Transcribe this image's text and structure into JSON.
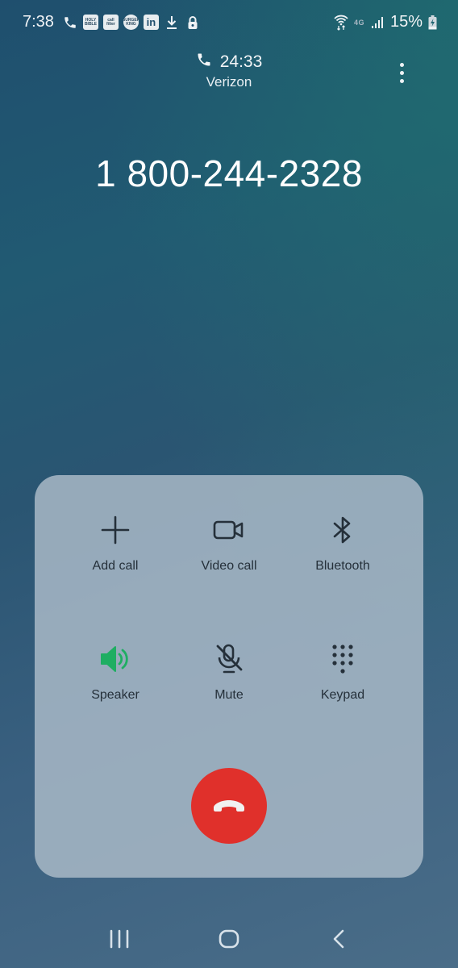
{
  "status_bar": {
    "time": "7:38",
    "notification_icons": [
      "phone-icon",
      "holy-bible-app-icon",
      "call-filter-app-icon",
      "burger-king-app-icon",
      "linkedin-app-icon",
      "download-icon",
      "lock-icon"
    ],
    "app_icon_labels": {
      "holy_bible": "HOLY BIBLE",
      "call_filter": "call filter",
      "burger_king": "BURGER KING",
      "linkedin": "in"
    },
    "network_type": "4G",
    "battery_percent": "15%",
    "right_icons": [
      "wifi-icon",
      "network-4g-icon",
      "signal-icon",
      "battery-charging-icon"
    ]
  },
  "call": {
    "timer": "24:33",
    "carrier": "Verizon",
    "number": "1 800-244-2328"
  },
  "controls": [
    {
      "id": "add-call",
      "label": "Add call",
      "icon": "plus-icon",
      "active": false
    },
    {
      "id": "video-call",
      "label": "Video call",
      "icon": "video-camera-icon",
      "active": false
    },
    {
      "id": "bluetooth",
      "label": "Bluetooth",
      "icon": "bluetooth-icon",
      "active": false
    },
    {
      "id": "speaker",
      "label": "Speaker",
      "icon": "speaker-icon",
      "active": true
    },
    {
      "id": "mute",
      "label": "Mute",
      "icon": "mic-off-icon",
      "active": false
    },
    {
      "id": "keypad",
      "label": "Keypad",
      "icon": "keypad-icon",
      "active": false
    }
  ],
  "colors": {
    "active_green": "#1fae62",
    "end_call_red": "#e0302b",
    "icon_dark": "#25303a"
  },
  "nav_bar": [
    "recent-apps",
    "home",
    "back"
  ]
}
